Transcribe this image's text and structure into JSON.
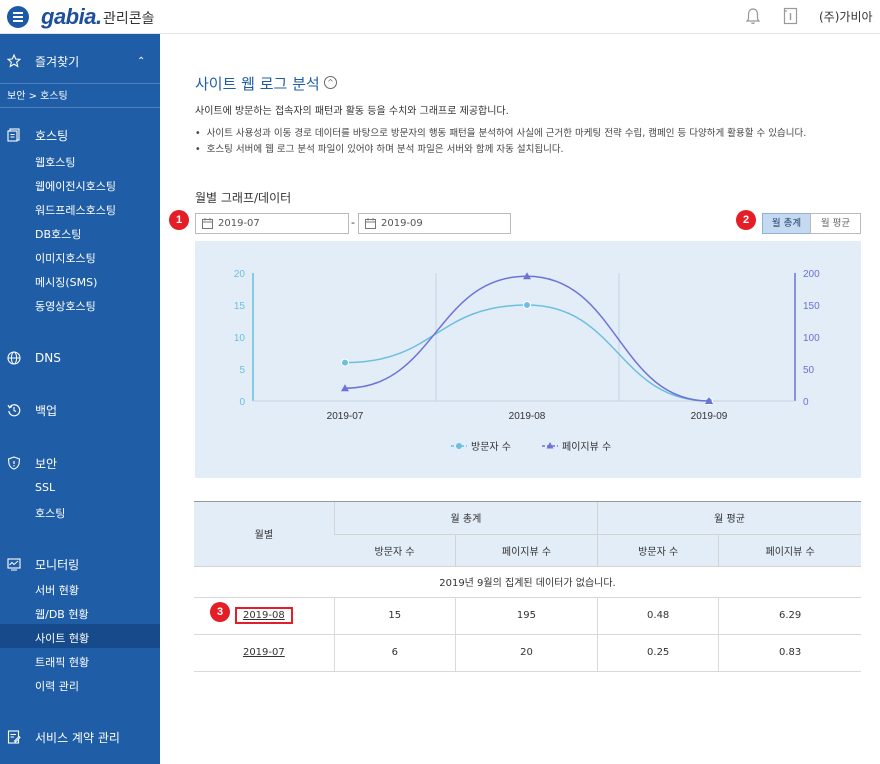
{
  "header": {
    "logo": "gabia.",
    "logo_sub": "관리콘솔",
    "user": "(주)가비아"
  },
  "sidebar": {
    "favorites": "즐겨찾기",
    "breadcrumb": "보안 > 호스팅",
    "hosting": "호스팅",
    "hosting_items": [
      "웹호스팅",
      "웹에이전시호스팅",
      "워드프레스호스팅",
      "DB호스팅",
      "이미지호스팅",
      "메시징(SMS)",
      "동영상호스팅"
    ],
    "dns": "DNS",
    "backup": "백업",
    "security": "보안",
    "security_items": [
      "SSL",
      "호스팅"
    ],
    "monitoring": "모니터링",
    "monitoring_items": [
      "서버 현황",
      "웹/DB 현황",
      "사이트 현황",
      "트래픽 현황",
      "이력 관리"
    ],
    "contract": "서비스 계약 관리"
  },
  "main": {
    "title": "사이트 웹 로그 분석",
    "collapse_icon": "^",
    "desc": "사이트에 방문하는 접속자의 패턴과 활동 등을 수치와 그래프로 제공합니다.",
    "bullets": [
      "사이트 사용성과 이동 경로 데이터를 바탕으로 방문자의 행동 패턴을 분석하여 사실에 근거한 마케팅 전략 수립, 캠페인 등 다양하게 활용할 수 있습니다.",
      "호스팅 서버에 웹 로그 분석 파일이 있어야 하며 분석 파일은 서버와 함께 자동 설치됩니다."
    ],
    "section_title": "월별 그래프/데이터",
    "date_from": "2019-07",
    "date_sep": "-",
    "date_to": "2019-09",
    "toggle_total": "월 총계",
    "toggle_avg": "월 평균",
    "badges": [
      "1",
      "2",
      "3"
    ]
  },
  "chart_data": {
    "type": "line",
    "categories": [
      "2019-07",
      "2019-08",
      "2019-09"
    ],
    "series": [
      {
        "name": "방문자 수",
        "values": [
          6,
          15,
          0
        ],
        "axis": "left",
        "color": "#6bbfdf",
        "marker": "circle"
      },
      {
        "name": "페이지뷰 수",
        "values": [
          20,
          195,
          0
        ],
        "axis": "right",
        "color": "#6c72d6",
        "marker": "triangle"
      }
    ],
    "left_ticks": [
      "0",
      "5",
      "10",
      "15",
      "20"
    ],
    "right_ticks": [
      "0",
      "50",
      "100",
      "150",
      "200"
    ],
    "ylim_left": [
      0,
      20
    ],
    "ylim_right": [
      0,
      200
    ],
    "legend_position": "bottom"
  },
  "table": {
    "col_month": "월별",
    "group_total": "월 총계",
    "group_avg": "월 평균",
    "sub_visitors": "방문자 수",
    "sub_pageviews": "페이지뷰 수",
    "note": "2019년 9월의 집계된 데이터가 없습니다.",
    "rows": [
      {
        "month": "2019-08",
        "visitors": "15",
        "pageviews": "195",
        "avg_visitors": "0.48",
        "avg_pageviews": "6.29"
      },
      {
        "month": "2019-07",
        "visitors": "6",
        "pageviews": "20",
        "avg_visitors": "0.25",
        "avg_pageviews": "0.83"
      }
    ]
  },
  "colors": {
    "sidebar": "#1f5ea6",
    "sidebar_active": "#164a8a",
    "accent": "#1f5ea6",
    "badge": "#e41e26",
    "chart_bg": "#e3edf7"
  }
}
